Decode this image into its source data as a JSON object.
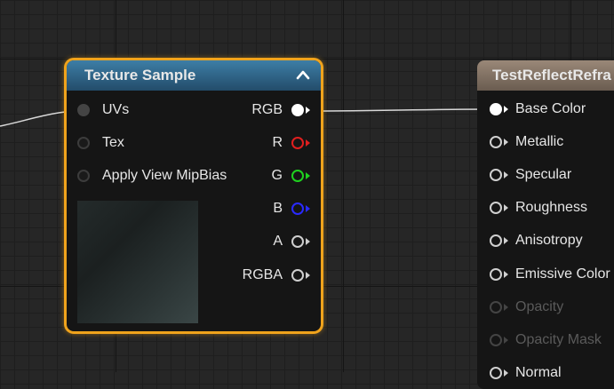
{
  "texture_node": {
    "title": "Texture Sample",
    "inputs": [
      {
        "label": "UVs",
        "pin": "dark-filled"
      },
      {
        "label": "Tex",
        "pin": "dark-empty"
      },
      {
        "label": "Apply View MipBias",
        "pin": "dark-empty"
      }
    ],
    "outputs": [
      {
        "label": "RGB",
        "color": "#ffffff"
      },
      {
        "label": "R",
        "color": "#e01f1f"
      },
      {
        "label": "G",
        "color": "#1fd11f"
      },
      {
        "label": "B",
        "color": "#2a2aff"
      },
      {
        "label": "A",
        "color": "#cfcfcf"
      },
      {
        "label": "RGBA",
        "color": "#cfcfcf"
      }
    ]
  },
  "material_node": {
    "title": "TestReflectRefra",
    "inputs": [
      {
        "label": "Base Color",
        "state": "connected"
      },
      {
        "label": "Metallic",
        "state": "normal"
      },
      {
        "label": "Specular",
        "state": "normal"
      },
      {
        "label": "Roughness",
        "state": "normal"
      },
      {
        "label": "Anisotropy",
        "state": "normal"
      },
      {
        "label": "Emissive Color",
        "state": "normal"
      },
      {
        "label": "Opacity",
        "state": "disabled"
      },
      {
        "label": "Opacity Mask",
        "state": "disabled"
      },
      {
        "label": "Normal",
        "state": "normal"
      }
    ]
  },
  "colors": {
    "selection": "#f0a31c",
    "texture_header": "#2f6b90",
    "material_header": "#8a7868",
    "wire": "#d8d8d8"
  }
}
